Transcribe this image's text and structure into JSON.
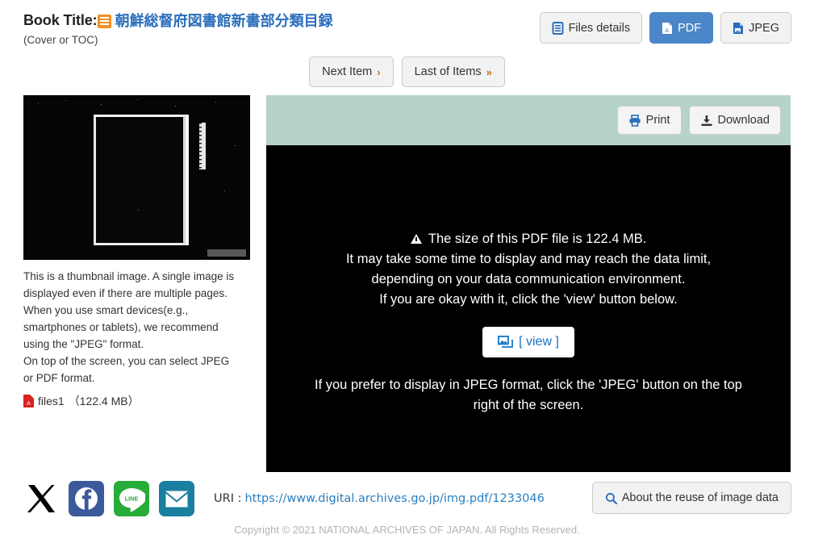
{
  "header": {
    "book_title_label": "Book Title:",
    "title_icon": "list-icon",
    "title_jp": "朝鮮総督府図書館新書部分類目録",
    "title_sub": "(Cover or TOC)",
    "format_buttons": [
      {
        "label": "Files details",
        "icon": "file-lines-icon",
        "active": false
      },
      {
        "label": "PDF",
        "icon": "pdf-file-icon",
        "active": true
      },
      {
        "label": "JPEG",
        "icon": "image-file-icon",
        "active": false
      }
    ]
  },
  "item_nav": [
    {
      "label": "Next Item",
      "chevron": "›",
      "icon": "chevron-right-icon"
    },
    {
      "label": "Last of Items",
      "chevron": "»",
      "icon": "chevron-double-right-icon"
    }
  ],
  "left": {
    "thumbnail_alt": "book-cover-thumbnail",
    "caption": "This is a thumbnail image. A single image is displayed even if there are multiple pages.\nWhen you use smart devices(e.g., smartphones or tablets), we recommend using the \"JPEG\" format.\nOn top of the screen, you can select JPEG or PDF format.",
    "file": {
      "icon": "pdf-file-icon",
      "name": "files1",
      "size": "（122.4 MB）"
    }
  },
  "viewer": {
    "bar_color": "#b6d3c9",
    "toolbar": [
      {
        "label": "Print",
        "icon": "printer-icon"
      },
      {
        "label": "Download",
        "icon": "download-icon"
      }
    ],
    "message_lines": [
      "The size of this PDF file is 122.4 MB.",
      "It may take some time to display and may reach the data limit,",
      "depending on your data communication environment.",
      "If you are okay with it, click the 'view' button below."
    ],
    "warning_icon": "warning-triangle-icon",
    "view_button": {
      "label": "[ view ]",
      "icon": "images-icon"
    },
    "message_lines_2": [
      "If you prefer to display in JPEG format, click the 'JPEG' button on the top",
      "right of the screen."
    ]
  },
  "footer": {
    "social": [
      {
        "name": "x-icon",
        "label": "X",
        "color": "#000000"
      },
      {
        "name": "facebook-icon",
        "label": "Facebook",
        "color": "#3a5a9b"
      },
      {
        "name": "line-icon",
        "label": "LINE",
        "color": "#27ab39"
      },
      {
        "name": "email-icon",
        "label": "Email",
        "color": "#1b7fa0"
      }
    ],
    "uri_label": "URI  :",
    "uri_value": "https://www.digital.archives.go.jp/img.pdf/1233046",
    "reuse_button": {
      "label": "About the reuse of image data",
      "icon": "search-icon"
    },
    "copyright": "Copyright © 2021 NATIONAL ARCHIVES OF JAPAN. All Rights Reserved."
  },
  "colors": {
    "accent_blue": "#2a6ebb",
    "primary_button": "#4a86c8",
    "viewer_header": "#b6d3c9",
    "title_icon_orange": "#f19024",
    "pdf_red": "#d8231f",
    "chevron_orange": "#c27126",
    "link_blue": "#2a7fbf"
  }
}
